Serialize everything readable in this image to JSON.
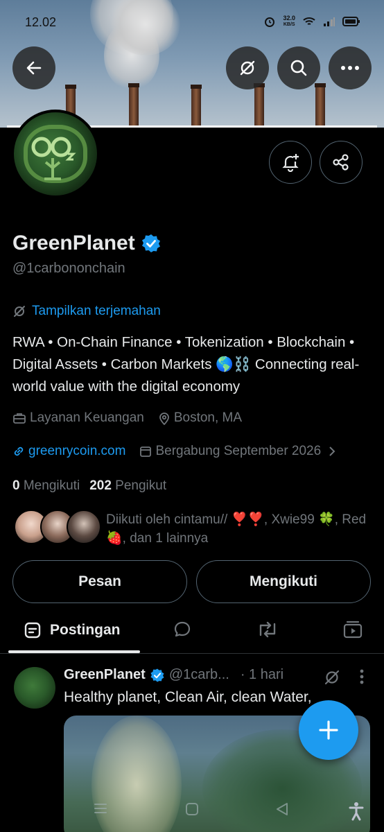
{
  "status": {
    "time": "12.02",
    "speed_value": "32.0",
    "speed_unit": "KB/S"
  },
  "profile": {
    "name": "GreenPlanet",
    "handle": "@1carbononchain",
    "translate_label": "Tampilkan terjemahan",
    "bio": "RWA • On-Chain Finance • Tokenization • Blockchain • Digital Assets • Carbon Markets 🌎⛓️ Connecting real-world value with the digital economy",
    "category": "Layanan Keuangan",
    "location": "Boston, MA",
    "website": "greenrycoin.com",
    "joined": "Bergabung September 2026",
    "following_count": "0",
    "following_label": "Mengikuti",
    "followers_count": "202",
    "followers_label": "Pengikut",
    "followed_by": "Diikuti oleh cintamu// ❣️❣️, Xwie99 🍀, Red 🍓, dan 1 lainnya"
  },
  "actions": {
    "message_label": "Pesan",
    "following_button_label": "Mengikuti"
  },
  "tabs": {
    "active_label": "Postingan"
  },
  "post": {
    "name": "GreenPlanet",
    "handle": "@1carb...",
    "time": "· 1 hari",
    "text": "Healthy planet, Clean Air, clean  Water,"
  },
  "colors": {
    "accent": "#1d9bf0",
    "background": "#000000",
    "muted": "#71767b",
    "verified": "#1d9bf0"
  }
}
